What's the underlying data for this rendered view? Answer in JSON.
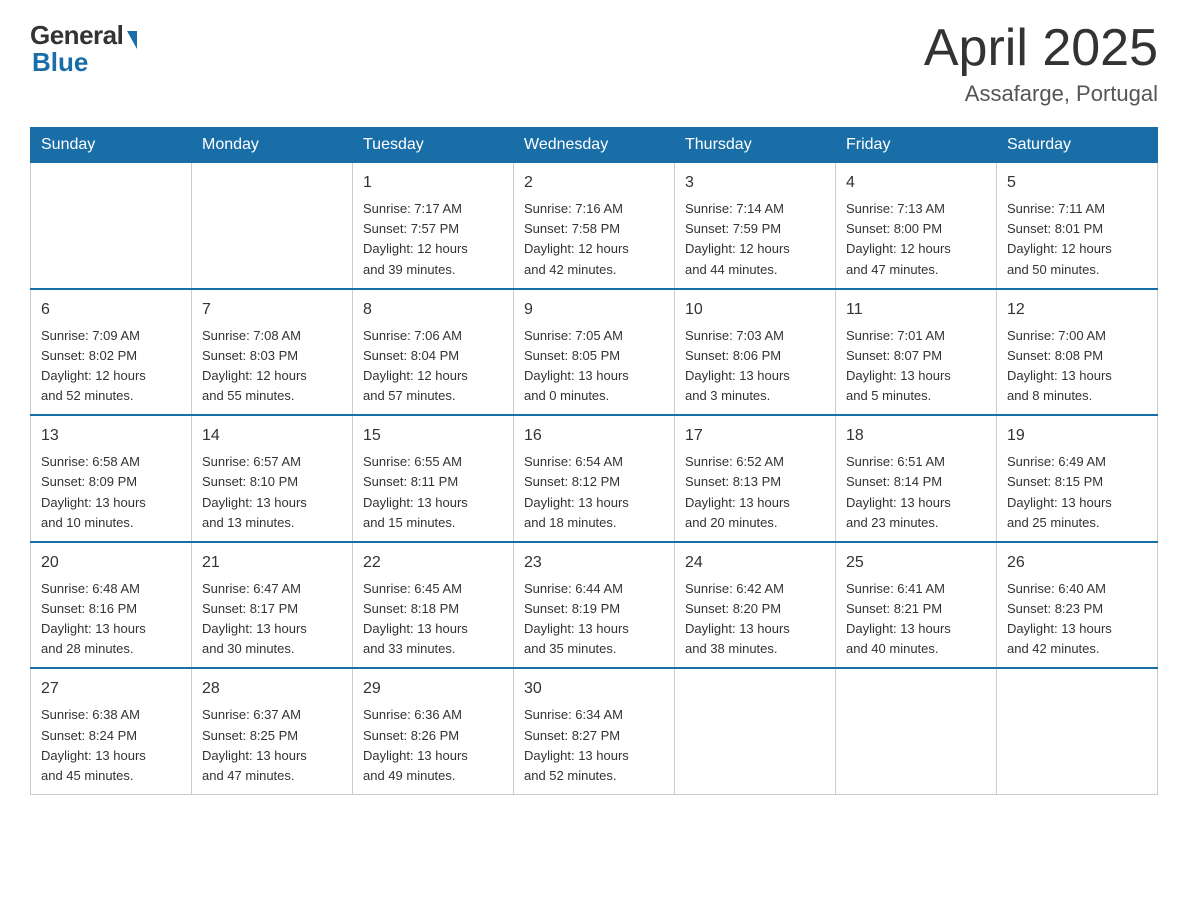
{
  "logo": {
    "general": "General",
    "blue": "Blue"
  },
  "header": {
    "title": "April 2025",
    "subtitle": "Assafarge, Portugal"
  },
  "weekdays": [
    "Sunday",
    "Monday",
    "Tuesday",
    "Wednesday",
    "Thursday",
    "Friday",
    "Saturday"
  ],
  "weeks": [
    [
      {
        "day": "",
        "info": ""
      },
      {
        "day": "",
        "info": ""
      },
      {
        "day": "1",
        "info": "Sunrise: 7:17 AM\nSunset: 7:57 PM\nDaylight: 12 hours\nand 39 minutes."
      },
      {
        "day": "2",
        "info": "Sunrise: 7:16 AM\nSunset: 7:58 PM\nDaylight: 12 hours\nand 42 minutes."
      },
      {
        "day": "3",
        "info": "Sunrise: 7:14 AM\nSunset: 7:59 PM\nDaylight: 12 hours\nand 44 minutes."
      },
      {
        "day": "4",
        "info": "Sunrise: 7:13 AM\nSunset: 8:00 PM\nDaylight: 12 hours\nand 47 minutes."
      },
      {
        "day": "5",
        "info": "Sunrise: 7:11 AM\nSunset: 8:01 PM\nDaylight: 12 hours\nand 50 minutes."
      }
    ],
    [
      {
        "day": "6",
        "info": "Sunrise: 7:09 AM\nSunset: 8:02 PM\nDaylight: 12 hours\nand 52 minutes."
      },
      {
        "day": "7",
        "info": "Sunrise: 7:08 AM\nSunset: 8:03 PM\nDaylight: 12 hours\nand 55 minutes."
      },
      {
        "day": "8",
        "info": "Sunrise: 7:06 AM\nSunset: 8:04 PM\nDaylight: 12 hours\nand 57 minutes."
      },
      {
        "day": "9",
        "info": "Sunrise: 7:05 AM\nSunset: 8:05 PM\nDaylight: 13 hours\nand 0 minutes."
      },
      {
        "day": "10",
        "info": "Sunrise: 7:03 AM\nSunset: 8:06 PM\nDaylight: 13 hours\nand 3 minutes."
      },
      {
        "day": "11",
        "info": "Sunrise: 7:01 AM\nSunset: 8:07 PM\nDaylight: 13 hours\nand 5 minutes."
      },
      {
        "day": "12",
        "info": "Sunrise: 7:00 AM\nSunset: 8:08 PM\nDaylight: 13 hours\nand 8 minutes."
      }
    ],
    [
      {
        "day": "13",
        "info": "Sunrise: 6:58 AM\nSunset: 8:09 PM\nDaylight: 13 hours\nand 10 minutes."
      },
      {
        "day": "14",
        "info": "Sunrise: 6:57 AM\nSunset: 8:10 PM\nDaylight: 13 hours\nand 13 minutes."
      },
      {
        "day": "15",
        "info": "Sunrise: 6:55 AM\nSunset: 8:11 PM\nDaylight: 13 hours\nand 15 minutes."
      },
      {
        "day": "16",
        "info": "Sunrise: 6:54 AM\nSunset: 8:12 PM\nDaylight: 13 hours\nand 18 minutes."
      },
      {
        "day": "17",
        "info": "Sunrise: 6:52 AM\nSunset: 8:13 PM\nDaylight: 13 hours\nand 20 minutes."
      },
      {
        "day": "18",
        "info": "Sunrise: 6:51 AM\nSunset: 8:14 PM\nDaylight: 13 hours\nand 23 minutes."
      },
      {
        "day": "19",
        "info": "Sunrise: 6:49 AM\nSunset: 8:15 PM\nDaylight: 13 hours\nand 25 minutes."
      }
    ],
    [
      {
        "day": "20",
        "info": "Sunrise: 6:48 AM\nSunset: 8:16 PM\nDaylight: 13 hours\nand 28 minutes."
      },
      {
        "day": "21",
        "info": "Sunrise: 6:47 AM\nSunset: 8:17 PM\nDaylight: 13 hours\nand 30 minutes."
      },
      {
        "day": "22",
        "info": "Sunrise: 6:45 AM\nSunset: 8:18 PM\nDaylight: 13 hours\nand 33 minutes."
      },
      {
        "day": "23",
        "info": "Sunrise: 6:44 AM\nSunset: 8:19 PM\nDaylight: 13 hours\nand 35 minutes."
      },
      {
        "day": "24",
        "info": "Sunrise: 6:42 AM\nSunset: 8:20 PM\nDaylight: 13 hours\nand 38 minutes."
      },
      {
        "day": "25",
        "info": "Sunrise: 6:41 AM\nSunset: 8:21 PM\nDaylight: 13 hours\nand 40 minutes."
      },
      {
        "day": "26",
        "info": "Sunrise: 6:40 AM\nSunset: 8:23 PM\nDaylight: 13 hours\nand 42 minutes."
      }
    ],
    [
      {
        "day": "27",
        "info": "Sunrise: 6:38 AM\nSunset: 8:24 PM\nDaylight: 13 hours\nand 45 minutes."
      },
      {
        "day": "28",
        "info": "Sunrise: 6:37 AM\nSunset: 8:25 PM\nDaylight: 13 hours\nand 47 minutes."
      },
      {
        "day": "29",
        "info": "Sunrise: 6:36 AM\nSunset: 8:26 PM\nDaylight: 13 hours\nand 49 minutes."
      },
      {
        "day": "30",
        "info": "Sunrise: 6:34 AM\nSunset: 8:27 PM\nDaylight: 13 hours\nand 52 minutes."
      },
      {
        "day": "",
        "info": ""
      },
      {
        "day": "",
        "info": ""
      },
      {
        "day": "",
        "info": ""
      }
    ]
  ]
}
